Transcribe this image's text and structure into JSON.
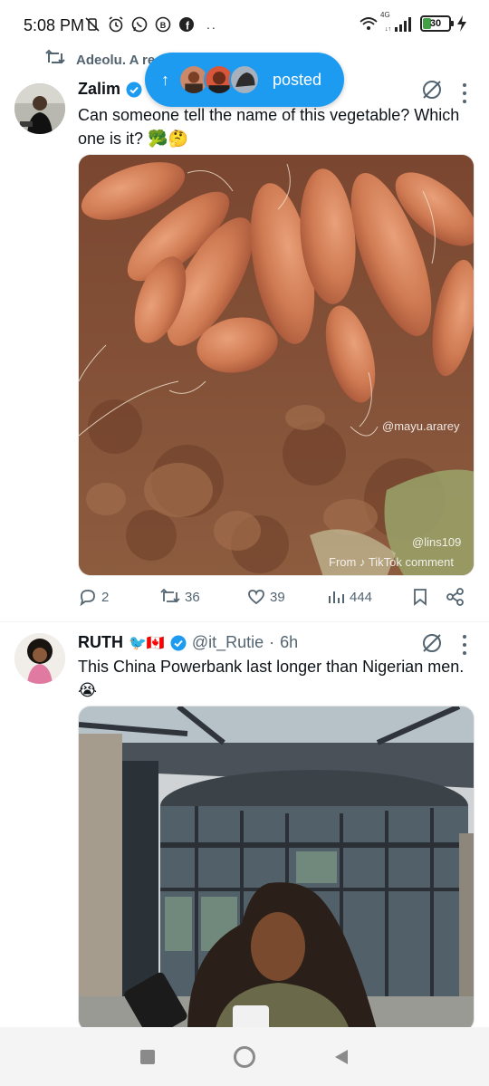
{
  "status_bar": {
    "time": "5:08 PM",
    "network_label": "4G",
    "battery_level": "30",
    "battery_percent": 30,
    "more_icon": "..",
    "icons": [
      "mute-vibrate-icon",
      "alarm-icon",
      "whatsapp-icon",
      "whatsapp-business-icon",
      "facebook-icon"
    ]
  },
  "repost_banner": {
    "text": "Adeolu. A re",
    "icon": "repost-icon"
  },
  "new_posts_pill": {
    "label": "posted",
    "icon": "arrow-up-icon",
    "accent": "#1d9bf0"
  },
  "tweets": [
    {
      "display_name": "Zalim",
      "handle": "",
      "time": "",
      "verified": true,
      "text": "Can someone tell the name of this vegetable? Which one is it? 🥦🤔",
      "media": {
        "watermark_top": "@mayu.ararey",
        "watermark_bottom_handle": "@lins109",
        "watermark_bottom_source": "From ♪ TikTok comment"
      },
      "stats": {
        "replies": "2",
        "reposts": "36",
        "likes": "39",
        "views": "444"
      }
    },
    {
      "display_name": "RUTH",
      "name_emojis": "🐦🇨🇦",
      "handle": "@it_Rutie",
      "dot": "·",
      "time": "6h",
      "verified": true,
      "text": "This China Powerbank last longer than Nigerian men. 😭"
    }
  ],
  "nav_bar": {
    "buttons": [
      "recents-square-icon",
      "home-circle-icon",
      "back-triangle-icon"
    ]
  },
  "colors": {
    "accent": "#1d9bf0",
    "secondary_text": "#536471",
    "primary_text": "#0f1419"
  }
}
